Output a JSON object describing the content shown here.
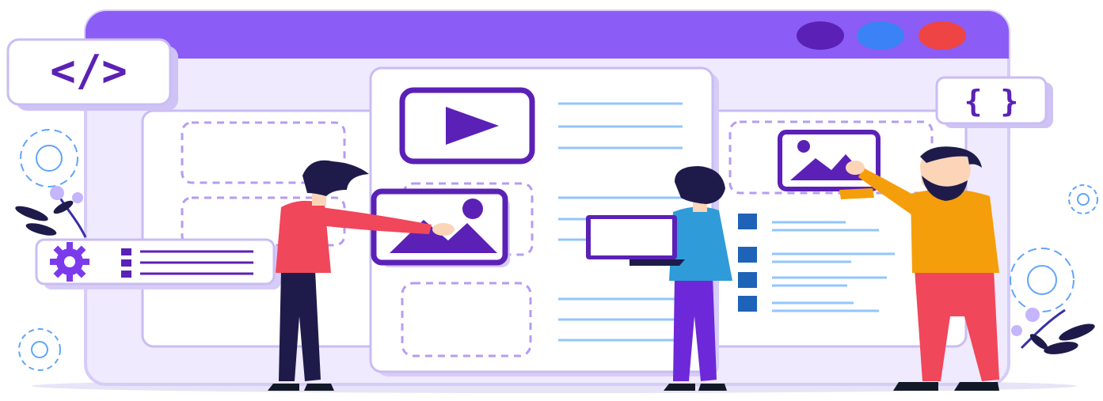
{
  "illustration": {
    "code_tag_label": "</>",
    "braces_label": "{ }",
    "colors": {
      "purple": "#8b5cf6",
      "deep_purple": "#5b21b6",
      "light_lavender": "#f3eefe",
      "blue_dot": "#3b82f6",
      "red_dot": "#ef4444",
      "line_blue": "#93c5fd"
    }
  }
}
